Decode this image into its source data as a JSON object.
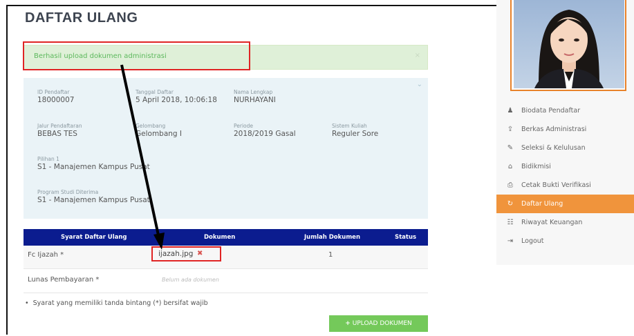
{
  "page": {
    "title": "DAFTAR ULANG"
  },
  "alert": {
    "message": "Berhasil upload dokumen administrasi",
    "close": "×"
  },
  "info": {
    "id_pendaftar": {
      "label": "ID Pendaftar",
      "value": "18000007"
    },
    "tanggal_daftar": {
      "label": "Tanggal Daftar",
      "value": "5 April 2018, 10:06:18"
    },
    "nama_lengkap": {
      "label": "Nama Lengkap",
      "value": "NURHAYANI"
    },
    "jalur": {
      "label": "Jalur Pendaftaran",
      "value": "BEBAS TES"
    },
    "gelombang": {
      "label": "Gelombang",
      "value": "Gelombang I"
    },
    "periode": {
      "label": "Periode",
      "value": "2018/2019 Gasal"
    },
    "sistem_kuliah": {
      "label": "Sistem Kuliah",
      "value": "Reguler Sore"
    },
    "pilihan": {
      "label": "Pilihan 1",
      "value": "S1 - Manajemen Kampus Pusat"
    },
    "prodi_diterima": {
      "label": "Program Studi Diterima",
      "value": "S1 - Manajemen Kampus Pusat"
    }
  },
  "table": {
    "headers": [
      "Syarat Daftar Ulang",
      "Dokumen",
      "Jumlah Dokumen",
      "Status"
    ],
    "rows": [
      {
        "syarat": "Fc Ijazah *",
        "dokumen": "ijazah.jpg",
        "jumlah": "1",
        "status": ""
      },
      {
        "syarat": "Lunas Pembayaran *",
        "dokumen": "Belum ada dokumen",
        "jumlah": "",
        "status": ""
      }
    ]
  },
  "note": "Syarat yang memiliki tanda bintang (*) bersifat wajib",
  "upload_button": {
    "icon": "+",
    "label": "UPLOAD DOKUMEN"
  },
  "sidebar": {
    "menu": [
      {
        "icon": "user-icon",
        "glyph": "♟",
        "label": "Biodata Pendaftar"
      },
      {
        "icon": "upload-icon",
        "glyph": "⇪",
        "label": "Berkas Administrasi"
      },
      {
        "icon": "edit-icon",
        "glyph": "✎",
        "label": "Seleksi & Kelulusan"
      },
      {
        "icon": "bank-icon",
        "glyph": "⌂",
        "label": "Bidikmisi"
      },
      {
        "icon": "print-icon",
        "glyph": "⎙",
        "label": "Cetak Bukti Verifikasi"
      },
      {
        "icon": "refresh-icon",
        "glyph": "↻",
        "label": "Daftar Ulang",
        "active": true
      },
      {
        "icon": "list-icon",
        "glyph": "☷",
        "label": "Riwayat Keuangan"
      },
      {
        "icon": "logout-icon",
        "glyph": "⇥",
        "label": "Logout"
      }
    ]
  },
  "colors": {
    "table_header": "#0b1c8f",
    "active_menu": "#f0943c",
    "alert_bg": "#dff0d8",
    "alert_text": "#5cb85c",
    "upload_button": "#74c95a",
    "highlight": "#e02424"
  }
}
